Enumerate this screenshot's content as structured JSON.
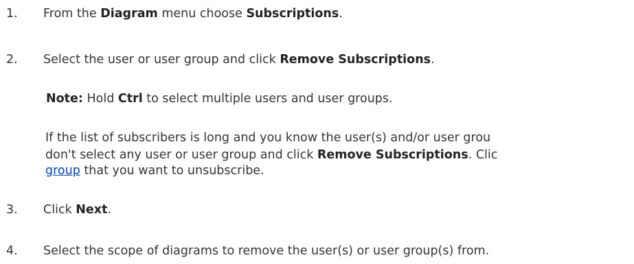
{
  "steps": [
    {
      "number": "1.",
      "t1": "From the ",
      "b1": "Diagram",
      "t2": " menu choose ",
      "b2": "Subscriptions",
      "t3": "."
    },
    {
      "number": "2.",
      "t1": "Select the user or user group and click ",
      "b1": "Remove Subscriptions",
      "t2": "."
    },
    {
      "number": "3.",
      "t1": "Click ",
      "b1": "Next",
      "t2": "."
    },
    {
      "number": "4.",
      "t1": "Select the scope of diagrams to remove the user(s) or user group(s) from."
    }
  ],
  "note": {
    "label": "Note:",
    "t1": " Hold ",
    "key": "Ctrl",
    "t2": " to select multiple users and user groups."
  },
  "para": {
    "line1": "If the list of subscribers is long and you know the user(s) and/or user grou",
    "line2_t1": "don't select any user or user group and click ",
    "line2_b1": "Remove Subscriptions",
    "line2_t2": ". Clic",
    "link": "group",
    "line3_t1": " that you want to unsubscribe."
  }
}
